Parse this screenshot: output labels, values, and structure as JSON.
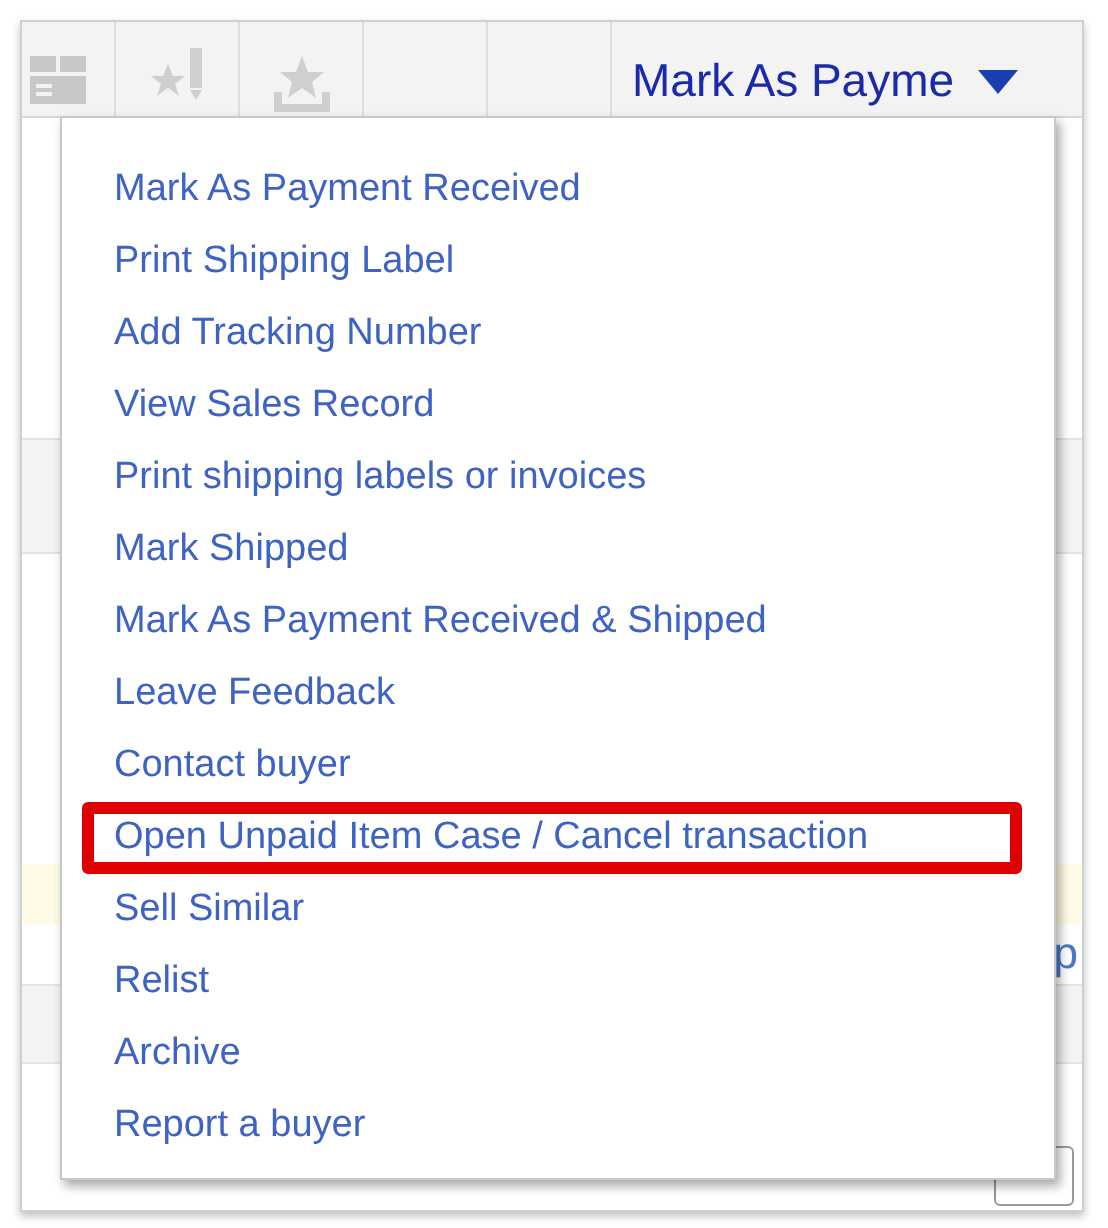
{
  "toolbar": {
    "action_label": "Mark As Payme"
  },
  "menu": {
    "items": [
      {
        "label": "Mark As Payment Received",
        "highlighted": false
      },
      {
        "label": "Print Shipping Label",
        "highlighted": false
      },
      {
        "label": "Add Tracking Number",
        "highlighted": false
      },
      {
        "label": "View Sales Record",
        "highlighted": false
      },
      {
        "label": "Print shipping labels or invoices",
        "highlighted": false
      },
      {
        "label": "Mark Shipped",
        "highlighted": false
      },
      {
        "label": "Mark As Payment Received & Shipped",
        "highlighted": false
      },
      {
        "label": "Leave Feedback",
        "highlighted": false
      },
      {
        "label": "Contact buyer",
        "highlighted": false
      },
      {
        "label": "Open Unpaid Item Case / Cancel transaction",
        "highlighted": true
      },
      {
        "label": "Sell Similar",
        "highlighted": false
      },
      {
        "label": "Relist",
        "highlighted": false
      },
      {
        "label": "Archive",
        "highlighted": false
      },
      {
        "label": "Report a buyer",
        "highlighted": false
      }
    ]
  },
  "background": {
    "link_fragment": "p"
  }
}
